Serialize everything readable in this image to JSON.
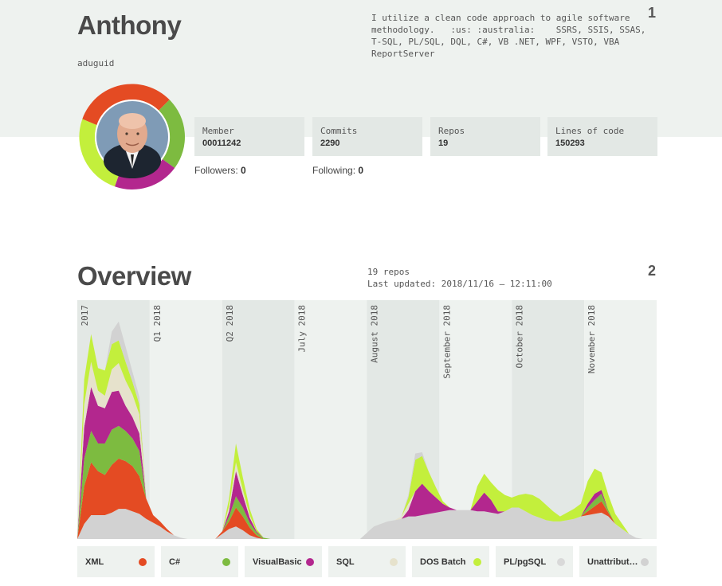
{
  "profile": {
    "name": "Anthony",
    "login": "aduguid",
    "bio": "I utilize a clean code approach to agile software\nmethodology.   :us: :australia:    SSRS, SSIS, SSAS,\nT-SQL, PL/SQL, DQL, C#, VB .NET, WPF, VSTO, VBA\nReportServer",
    "page_number": "1",
    "stats": [
      {
        "label": "Member",
        "value": "00011242"
      },
      {
        "label": "Commits",
        "value": "2290"
      },
      {
        "label": "Repos",
        "value": "19"
      },
      {
        "label": "Lines of code",
        "value": "150293"
      }
    ],
    "followers_label": "Followers:",
    "followers": "0",
    "following_label": "Following:",
    "following": "0"
  },
  "overview": {
    "title": "Overview",
    "page_number": "2",
    "repos_text": "19 repos",
    "updated_text": "Last updated: 2018/11/16 – 12:11:00"
  },
  "colors": {
    "XML": "#e44b23",
    "C#": "#7dbb40",
    "VisualBasic": "#b3278e",
    "SQL": "#e6e2cc",
    "DOS Batch": "#c3ef3c",
    "PL/pgSQL": "#d9d9d9",
    "Unattributed": "#d2d2d2",
    "band_dark": "#e3e8e5",
    "band_light": "#eef2ef"
  },
  "chart_data": {
    "type": "area",
    "stacked": true,
    "time_labels": [
      "2017",
      "Q1 2018",
      "Q2 2018",
      "July 2018",
      "August 2018",
      "September 2018",
      "October 2018",
      "November 2018"
    ],
    "x": [
      0,
      1,
      2,
      3,
      4,
      5,
      6,
      7,
      8,
      9,
      10,
      11,
      12,
      13,
      14,
      15,
      16,
      17,
      18,
      19,
      20,
      21,
      22,
      23,
      24,
      25,
      26,
      27,
      28,
      29,
      30,
      31,
      32,
      33,
      34,
      35,
      36,
      37,
      38,
      39,
      40,
      41,
      42,
      43,
      44,
      45,
      46,
      47,
      48,
      49,
      50,
      51,
      52,
      53,
      54,
      55,
      56,
      57,
      58,
      59,
      60,
      61,
      62,
      63,
      64,
      65,
      66,
      67,
      68,
      69,
      70,
      71,
      72,
      73,
      74,
      75,
      76,
      77,
      78,
      79,
      80,
      81,
      82,
      83,
      84
    ],
    "series": [
      {
        "name": "Unattributed",
        "values": [
          0,
          12,
          19,
          19,
          19,
          21,
          24,
          24,
          22,
          20,
          16,
          13,
          10,
          6,
          3,
          1,
          0,
          0,
          0,
          0,
          0,
          4,
          8,
          10,
          7,
          3,
          1,
          0,
          0,
          0,
          0,
          0,
          0,
          0,
          0,
          0,
          0,
          0,
          0,
          0,
          0,
          0,
          5,
          10,
          12,
          14,
          15,
          16,
          18,
          18,
          19,
          20,
          21,
          22,
          23,
          23,
          23,
          23,
          22,
          22,
          21,
          20,
          22,
          25,
          25,
          22,
          19,
          17,
          15,
          14,
          14,
          15,
          16,
          18,
          19,
          20,
          21,
          18,
          12,
          8,
          4,
          1,
          0,
          0,
          0
        ]
      },
      {
        "name": "PL/pgSQL",
        "values": [
          0,
          0,
          0,
          0,
          0,
          0,
          0,
          0,
          0,
          0,
          0,
          0,
          0,
          0,
          0,
          0,
          0,
          0,
          0,
          0,
          0,
          0,
          0,
          0,
          0,
          0,
          0,
          0,
          0,
          0,
          0,
          0,
          0,
          0,
          0,
          0,
          0,
          0,
          0,
          0,
          0,
          0,
          0,
          0,
          0,
          0,
          0,
          0,
          0,
          0,
          0,
          0,
          0,
          0,
          0,
          0,
          0,
          0,
          0,
          0,
          0,
          0,
          0,
          0,
          0,
          0,
          0,
          0,
          0,
          0,
          0,
          0,
          0,
          0,
          0,
          0,
          0,
          0,
          0,
          0,
          0,
          0,
          0,
          0,
          0
        ]
      },
      {
        "name": "DOS Batch",
        "values": [
          0,
          0,
          0,
          0,
          0,
          0,
          0,
          0,
          0,
          0,
          0,
          0,
          0,
          0,
          0,
          0,
          0,
          0,
          0,
          0,
          0,
          0,
          0,
          0,
          0,
          0,
          0,
          0,
          0,
          0,
          0,
          0,
          0,
          0,
          0,
          0,
          0,
          0,
          0,
          0,
          0,
          0,
          0,
          0,
          0,
          0,
          0,
          0,
          0,
          0,
          0,
          0,
          0,
          0,
          0,
          0,
          0,
          0,
          0,
          0,
          0,
          0,
          0,
          0,
          0,
          0,
          0,
          0,
          0,
          0,
          0,
          0,
          0,
          0,
          0,
          0,
          0,
          0,
          0,
          0,
          0,
          0,
          0,
          0,
          0
        ]
      },
      {
        "name": "XML",
        "values": [
          0,
          30,
          42,
          35,
          32,
          38,
          40,
          38,
          36,
          30,
          16,
          6,
          4,
          2,
          0,
          0,
          0,
          0,
          0,
          0,
          0,
          2,
          6,
          15,
          11,
          6,
          2,
          0,
          0,
          0,
          0,
          0,
          0,
          0,
          0,
          0,
          0,
          0,
          0,
          0,
          0,
          0,
          0,
          0,
          0,
          0,
          0,
          0,
          0,
          0,
          0,
          0,
          0,
          0,
          0,
          0,
          0,
          0,
          0,
          0,
          0,
          0,
          0,
          0,
          0,
          0,
          0,
          0,
          0,
          0,
          0,
          0,
          0,
          0,
          3,
          6,
          9,
          3,
          0,
          0,
          0,
          0,
          0,
          0,
          0
        ]
      },
      {
        "name": "C#",
        "values": [
          0,
          22,
          25,
          22,
          25,
          28,
          26,
          24,
          22,
          20,
          0,
          0,
          0,
          0,
          0,
          0,
          0,
          0,
          0,
          0,
          0,
          0,
          4,
          9,
          7,
          4,
          2,
          1,
          0,
          0,
          0,
          0,
          0,
          0,
          0,
          0,
          0,
          0,
          0,
          0,
          0,
          0,
          0,
          0,
          0,
          0,
          0,
          0,
          0,
          0,
          0,
          0,
          0,
          0,
          0,
          0,
          0,
          0,
          0,
          0,
          0,
          0,
          0,
          0,
          0,
          0,
          0,
          0,
          0,
          0,
          0,
          0,
          0,
          0,
          3,
          5,
          6,
          2,
          0,
          0,
          0,
          0,
          0,
          0,
          0
        ]
      },
      {
        "name": "VisualBasic",
        "values": [
          0,
          25,
          35,
          30,
          28,
          30,
          28,
          20,
          17,
          14,
          0,
          0,
          0,
          0,
          0,
          0,
          0,
          0,
          0,
          0,
          0,
          0,
          4,
          20,
          10,
          4,
          1,
          0,
          0,
          0,
          0,
          0,
          0,
          0,
          0,
          0,
          0,
          0,
          0,
          0,
          0,
          0,
          0,
          0,
          0,
          0,
          0,
          0,
          5,
          20,
          25,
          18,
          12,
          6,
          2,
          0,
          0,
          0,
          8,
          15,
          10,
          2,
          0,
          0,
          0,
          0,
          0,
          0,
          0,
          0,
          0,
          0,
          0,
          0,
          3,
          5,
          3,
          0,
          0,
          0,
          0,
          0,
          0,
          0,
          0
        ]
      },
      {
        "name": "SQL",
        "values": [
          0,
          18,
          20,
          12,
          10,
          18,
          22,
          20,
          18,
          15,
          0,
          0,
          0,
          0,
          0,
          0,
          0,
          0,
          0,
          0,
          0,
          0,
          4,
          7,
          4,
          2,
          0,
          0,
          0,
          0,
          0,
          0,
          0,
          0,
          0,
          0,
          0,
          0,
          0,
          0,
          0,
          0,
          0,
          0,
          0,
          0,
          0,
          2,
          5,
          0,
          0,
          0,
          0,
          0,
          0,
          0,
          0,
          0,
          0,
          0,
          0,
          0,
          0,
          0,
          0,
          0,
          0,
          0,
          0,
          0,
          0,
          0,
          0,
          0,
          0,
          0,
          0,
          0,
          0,
          0,
          0,
          0,
          0,
          0,
          0
        ]
      },
      {
        "name": "DOS Batch (upper)",
        "values": [
          0,
          20,
          22,
          18,
          20,
          20,
          18,
          15,
          10,
          8,
          0,
          0,
          0,
          0,
          0,
          0,
          0,
          0,
          0,
          0,
          0,
          0,
          6,
          15,
          10,
          5,
          2,
          0,
          0,
          0,
          0,
          0,
          0,
          0,
          0,
          0,
          0,
          0,
          0,
          0,
          0,
          0,
          0,
          0,
          0,
          0,
          0,
          0,
          5,
          25,
          22,
          15,
          8,
          2,
          0,
          0,
          0,
          0,
          12,
          15,
          14,
          17,
          13,
          8,
          10,
          14,
          16,
          15,
          12,
          8,
          4,
          6,
          8,
          10,
          18,
          20,
          14,
          12,
          8,
          4,
          0,
          0,
          0,
          0,
          0
        ]
      },
      {
        "name": "Unattributed (upper)",
        "values": [
          0,
          0,
          0,
          0,
          0,
          10,
          15,
          12,
          8,
          6,
          0,
          0,
          0,
          0,
          0,
          0,
          0,
          0,
          0,
          0,
          0,
          0,
          0,
          0,
          0,
          0,
          0,
          0,
          0,
          0,
          0,
          0,
          0,
          0,
          0,
          0,
          0,
          0,
          0,
          0,
          0,
          0,
          0,
          0,
          0,
          0,
          0,
          0,
          2,
          5,
          3,
          0,
          0,
          0,
          0,
          0,
          0,
          0,
          0,
          0,
          0,
          0,
          0,
          0,
          0,
          0,
          0,
          0,
          0,
          0,
          0,
          0,
          0,
          0,
          0,
          0,
          0,
          0,
          0,
          0,
          0,
          0,
          0,
          0,
          0
        ]
      }
    ],
    "ylim": [
      0,
      190
    ]
  },
  "legend": [
    {
      "name": "XML",
      "color": "#e44b23"
    },
    {
      "name": "C#",
      "color": "#7dbb40"
    },
    {
      "name": "VisualBasic",
      "color": "#b3278e"
    },
    {
      "name": "SQL",
      "color": "#e6e2cc"
    },
    {
      "name": "DOS Batch",
      "color": "#c3ef3c"
    },
    {
      "name": "PL/pgSQL",
      "color": "#d9d9d9"
    },
    {
      "name": "Unattributed",
      "color": "#d2d2d2"
    }
  ]
}
